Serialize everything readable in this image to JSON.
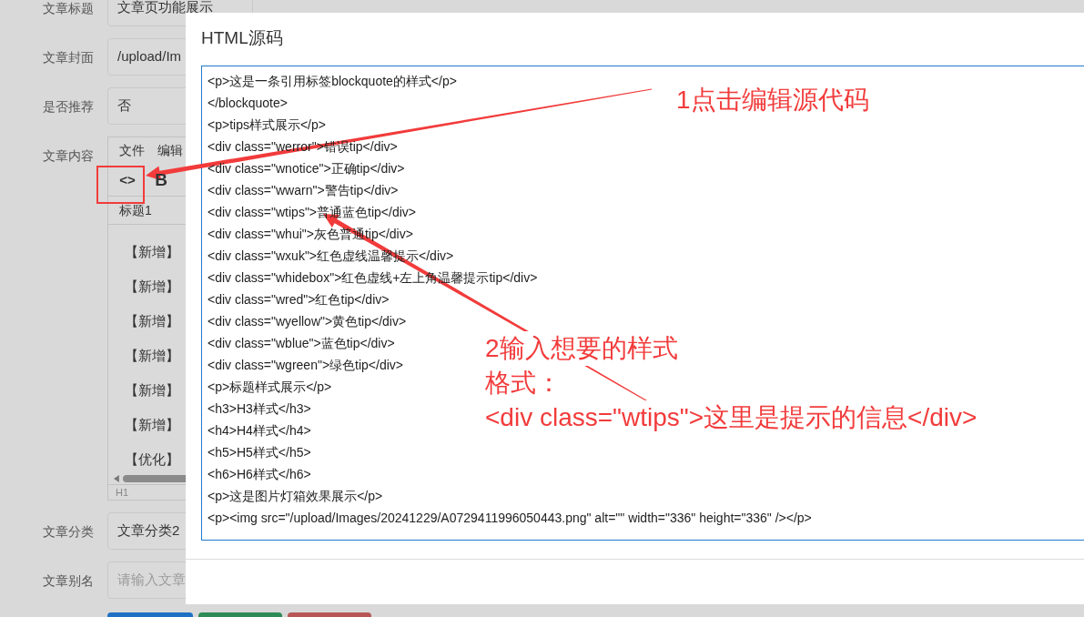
{
  "form": {
    "fields": [
      {
        "label": "文章标题",
        "value": "文章页功能展示",
        "kind": "text"
      },
      {
        "label": "文章封面",
        "value": "/upload/Im",
        "kind": "text"
      },
      {
        "label": "是否推荐",
        "value": "否",
        "kind": "text"
      },
      {
        "label": "文章内容",
        "kind": "editor"
      },
      {
        "label": "文章分类",
        "value": "文章分类2",
        "kind": "text"
      },
      {
        "label": "文章别名",
        "placeholder": "请输入文章",
        "kind": "input"
      }
    ]
  },
  "editor": {
    "menu": [
      "文件",
      "编辑"
    ],
    "toolbar": {
      "source_button": "<>",
      "bold_button": "B"
    },
    "format_select": "标题1",
    "content_lines": [
      "【新增】",
      "【新增】",
      "【新增】",
      "【新增】",
      "【新增】",
      "【新增】",
      "【优化】"
    ],
    "status_bar": "H1"
  },
  "modal": {
    "title": "HTML源码",
    "code_lines": [
      "<p>这是一条引用标签blockquote的样式</p>",
      "</blockquote>",
      "<p>tips样式展示</p>",
      "<div class=\"werror\">错误tip</div>",
      "<div class=\"wnotice\">正确tip</div>",
      "<div class=\"wwarn\">警告tip</div>",
      "<div class=\"wtips\">普通蓝色tip</div>",
      "<div class=\"whui\">灰色普通tip</div>",
      "<div class=\"wxuk\">红色虚线温馨提示</div>",
      "<div class=\"whidebox\">红色虚线+左上角温馨提示tip</div>",
      "<div class=\"wred\">红色tip</div>",
      "<div class=\"wyellow\">黄色tip</div>",
      "<div class=\"wblue\">蓝色tip</div>",
      "<div class=\"wgreen\">绿色tip</div>",
      "<p>标题样式展示</p>",
      "<h3>H3样式</h3>",
      "<h4>H4样式</h4>",
      "<h5>H5样式</h5>",
      "<h6>H6样式</h6>",
      "<p>这是图片灯箱效果展示</p>",
      "<p><img src=\"/upload/Images/20241229/A0729411996050443.png\" alt=\"\" width=\"336\" height=\"336\" /></p>"
    ]
  },
  "annotations": {
    "step_1": "1点击编辑源代码",
    "step_2": [
      "2输入想要的样式",
      "格式：",
      "<div class=\"wtips\">这里是提示的信息</div>"
    ]
  }
}
